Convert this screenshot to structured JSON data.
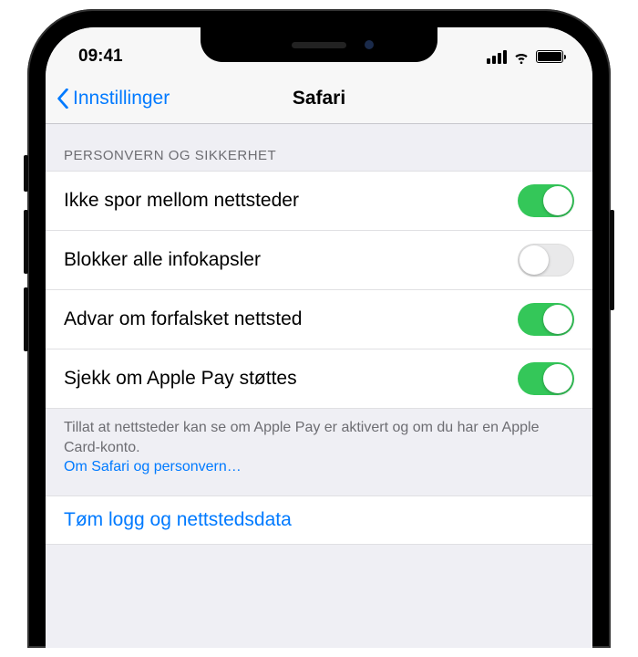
{
  "status": {
    "time": "09:41"
  },
  "nav": {
    "back": "Innstillinger",
    "title": "Safari"
  },
  "section": {
    "header": "PERSONVERN OG SIKKERHET"
  },
  "rows": {
    "prevent_tracking": {
      "label": "Ikke spor mellom nettsteder",
      "on": true
    },
    "block_cookies": {
      "label": "Blokker alle infokapsler",
      "on": false
    },
    "fraud_warning": {
      "label": "Advar om forfalsket nettsted",
      "on": true
    },
    "apple_pay_check": {
      "label": "Sjekk om Apple Pay støttes",
      "on": true
    }
  },
  "footer": {
    "text": "Tillat at nettsteder kan se om Apple Pay er aktivert og om du har en Apple Card-konto.",
    "link": "Om Safari og personvern…"
  },
  "clear": {
    "label": "Tøm logg og nettstedsdata"
  }
}
